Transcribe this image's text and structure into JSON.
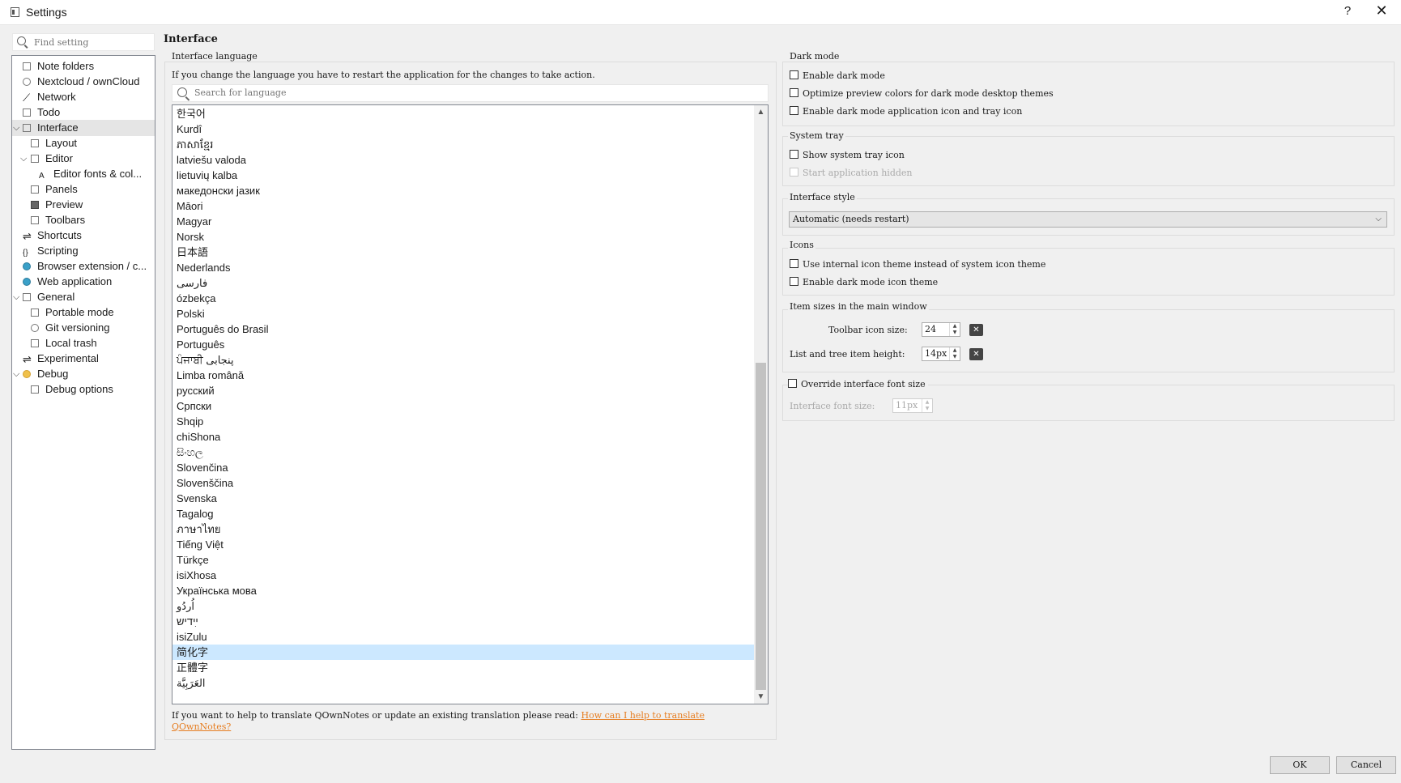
{
  "window": {
    "title": "Settings",
    "help": "?",
    "close": "✕"
  },
  "sidebar": {
    "search_placeholder": "Find setting",
    "items": [
      {
        "label": "Note folders"
      },
      {
        "label": "Nextcloud / ownCloud"
      },
      {
        "label": "Network"
      },
      {
        "label": "Todo"
      },
      {
        "label": "Interface"
      },
      {
        "label": "Layout"
      },
      {
        "label": "Editor"
      },
      {
        "label": "Editor fonts & col..."
      },
      {
        "label": "Panels"
      },
      {
        "label": "Preview"
      },
      {
        "label": "Toolbars"
      },
      {
        "label": "Shortcuts"
      },
      {
        "label": "Scripting"
      },
      {
        "label": "Browser extension / c..."
      },
      {
        "label": "Web application"
      },
      {
        "label": "General"
      },
      {
        "label": "Portable mode"
      },
      {
        "label": "Git versioning"
      },
      {
        "label": "Local trash"
      },
      {
        "label": "Experimental"
      },
      {
        "label": "Debug"
      },
      {
        "label": "Debug options"
      }
    ]
  },
  "page": {
    "title": "Interface",
    "language": {
      "group_title": "Interface language",
      "note": "If you change the language you have to restart the application for the changes to take action.",
      "search_placeholder": "Search for language",
      "items": [
        "한국어",
        "Kurdî",
        "ភាសាខ្មែរ",
        "latviešu valoda",
        "lietuvių kalba",
        "македонски јазик",
        "Māori",
        "Magyar",
        "Norsk",
        "日本語",
        "Nederlands",
        "فارسی",
        "ózbekça",
        "Polski",
        "Português do Brasil",
        "Português",
        "ਪੰਜਾਬੀ پنجابی",
        "Limba română",
        "русский",
        "Српски",
        "Shqip",
        "chiShona",
        "සිංහල",
        "Slovenčina",
        "Slovenščina",
        "Svenska",
        "Tagalog",
        "ภาษาไทย",
        "Tiếng Việt",
        "Türkçe",
        "isiXhosa",
        "Українська мова",
        "اُردُو",
        "ײִדיש",
        "isiZulu",
        "简化字",
        "正體字",
        "العَرَبِيَّة"
      ],
      "selected": "简化字",
      "help_text": "If you want to help to translate QOwnNotes or update an existing translation please read: ",
      "help_link": "How can I help to translate",
      "help_link2": "QOwnNotes?"
    },
    "dark_mode": {
      "group_title": "Dark mode",
      "enable": "Enable dark mode",
      "optimize": "Optimize preview colors for dark mode desktop themes",
      "tray_icon": "Enable dark mode application icon and tray icon"
    },
    "system_tray": {
      "group_title": "System tray",
      "show": "Show system tray icon",
      "hidden": "Start application hidden"
    },
    "interface_style": {
      "group_title": "Interface style",
      "value": "Automatic (needs restart)"
    },
    "icons": {
      "group_title": "Icons",
      "internal": "Use internal icon theme instead of system icon theme",
      "dark": "Enable dark mode icon theme"
    },
    "item_sizes": {
      "group_title": "Item sizes in the main window",
      "toolbar_label": "Toolbar icon size:",
      "toolbar_value": "24",
      "list_label": "List and tree item height:",
      "list_value": "14px"
    },
    "font_override": {
      "group_title": "Override interface font size",
      "label": "Interface font size:",
      "value": "11px"
    }
  },
  "footer": {
    "ok": "OK",
    "cancel": "Cancel"
  }
}
